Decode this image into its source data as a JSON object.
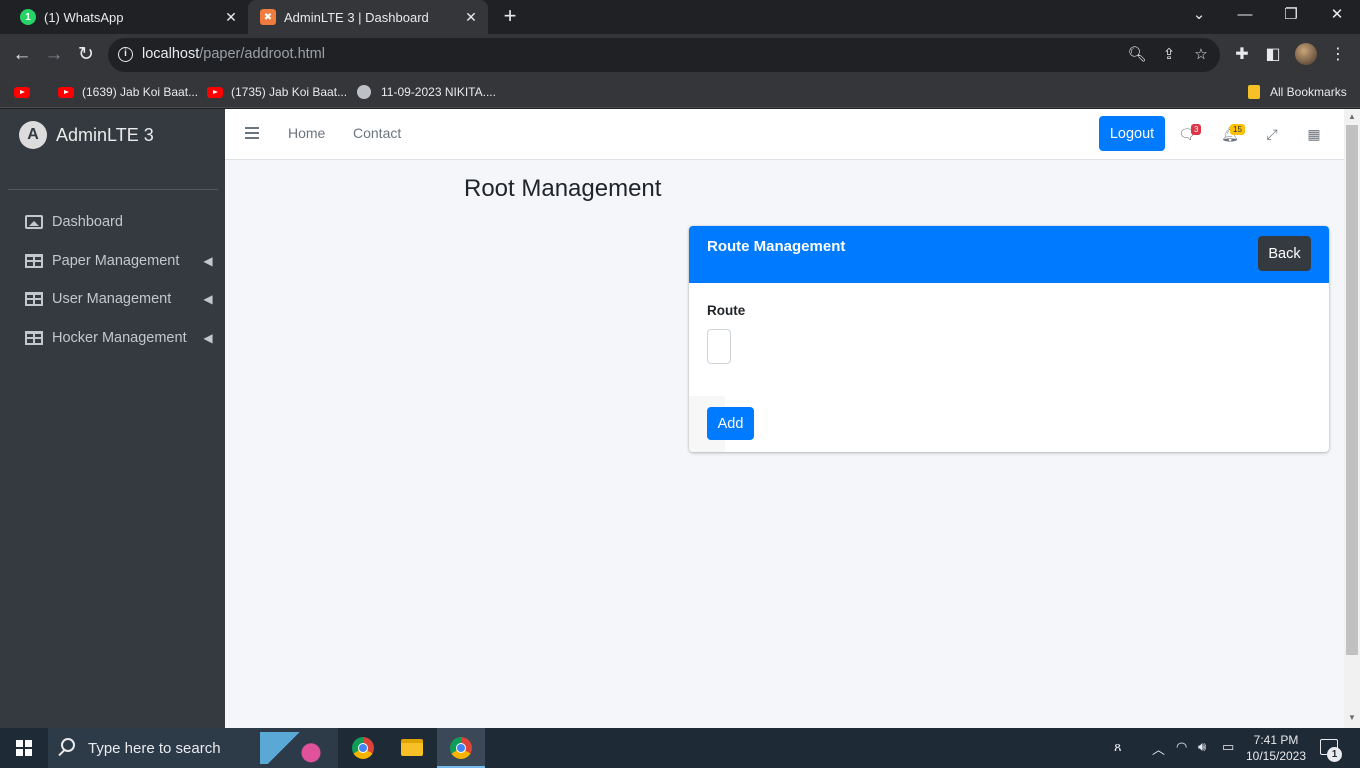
{
  "browser": {
    "tabs": [
      {
        "title": "(1) WhatsApp",
        "favicon_badge": "1",
        "favicon_color": "#25d366",
        "active": false
      },
      {
        "title": "AdminLTE 3 | Dashboard",
        "favicon_color": "#f07b3f",
        "active": true
      }
    ],
    "url_host": "localhost",
    "url_path": "/paper/addroot.html",
    "bookmarks": [
      {
        "label": "",
        "icon": "youtube-icon"
      },
      {
        "label": "(1639) Jab Koi Baat...",
        "icon": "youtube-icon"
      },
      {
        "label": "(1735) Jab Koi Baat...",
        "icon": "youtube-icon"
      },
      {
        "label": "11-09-2023 NIKITA....",
        "icon": "globe-icon"
      }
    ],
    "all_bookmarks": "All Bookmarks"
  },
  "sidebar": {
    "brand": "AdminLTE 3",
    "brand_logo_letter": "A",
    "items": [
      {
        "label": "Dashboard",
        "icon": "image-icon",
        "has_submenu": false
      },
      {
        "label": "Paper Management",
        "icon": "table-icon",
        "has_submenu": true
      },
      {
        "label": "User Management",
        "icon": "table-icon",
        "has_submenu": true
      },
      {
        "label": "Hocker Management",
        "icon": "table-icon",
        "has_submenu": true
      }
    ]
  },
  "topnav": {
    "links": [
      "Home",
      "Contact"
    ],
    "logout_label": "Logout",
    "messages_count": "3",
    "notifications_count": "15"
  },
  "main": {
    "page_title": "Root Management",
    "card": {
      "title": "Route Management",
      "back_label": "Back",
      "field_label": "Route",
      "field_value": "",
      "add_label": "Add"
    }
  },
  "taskbar": {
    "search_placeholder": "Type here to search",
    "time": "7:41 PM",
    "date": "10/15/2023",
    "notification_count": "1"
  },
  "colors": {
    "primary": "#007bff",
    "sidebar_bg": "#343a40",
    "content_bg": "#f4f6f9",
    "back_button": "#343a40",
    "badge_danger": "#dc3545",
    "badge_warning": "#ffc107"
  }
}
